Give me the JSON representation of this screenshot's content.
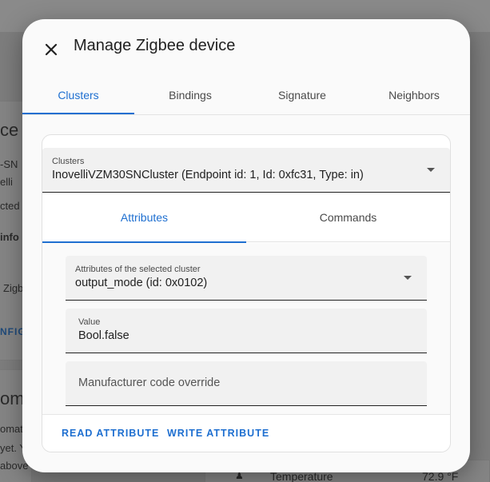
{
  "background": {
    "left_fragments": [
      "ce",
      "-SN",
      "elli",
      "cted",
      "info",
      "Zigb",
      "NFIG",
      "oma",
      "omat",
      "yet. Y",
      "above"
    ],
    "sensor_label": "Temperature",
    "sensor_value": "72.9 °F"
  },
  "dialog": {
    "title": "Manage Zigbee device",
    "close_icon": "close-icon",
    "tabs": [
      {
        "label": "Clusters",
        "active": true
      },
      {
        "label": "Bindings",
        "active": false
      },
      {
        "label": "Signature",
        "active": false
      },
      {
        "label": "Neighbors",
        "active": false
      }
    ]
  },
  "clusters": {
    "select_label": "Clusters",
    "select_value": "InovelliVZM30SNCluster (Endpoint id: 1, Id: 0xfc31, Type: in)",
    "subtabs": [
      {
        "label": "Attributes",
        "active": true
      },
      {
        "label": "Commands",
        "active": false
      }
    ],
    "attribute_select_label": "Attributes of the selected cluster",
    "attribute_select_value": "output_mode (id: 0x0102)",
    "value_label": "Value",
    "value": "Bool.false",
    "manufacturer_placeholder": "Manufacturer code override",
    "read_button": "READ ATTRIBUTE",
    "write_button": "WRITE ATTRIBUTE"
  },
  "colors": {
    "accent": "#1e6fd0",
    "scrim": "#7d7d7d",
    "surface": "#fafafa"
  }
}
